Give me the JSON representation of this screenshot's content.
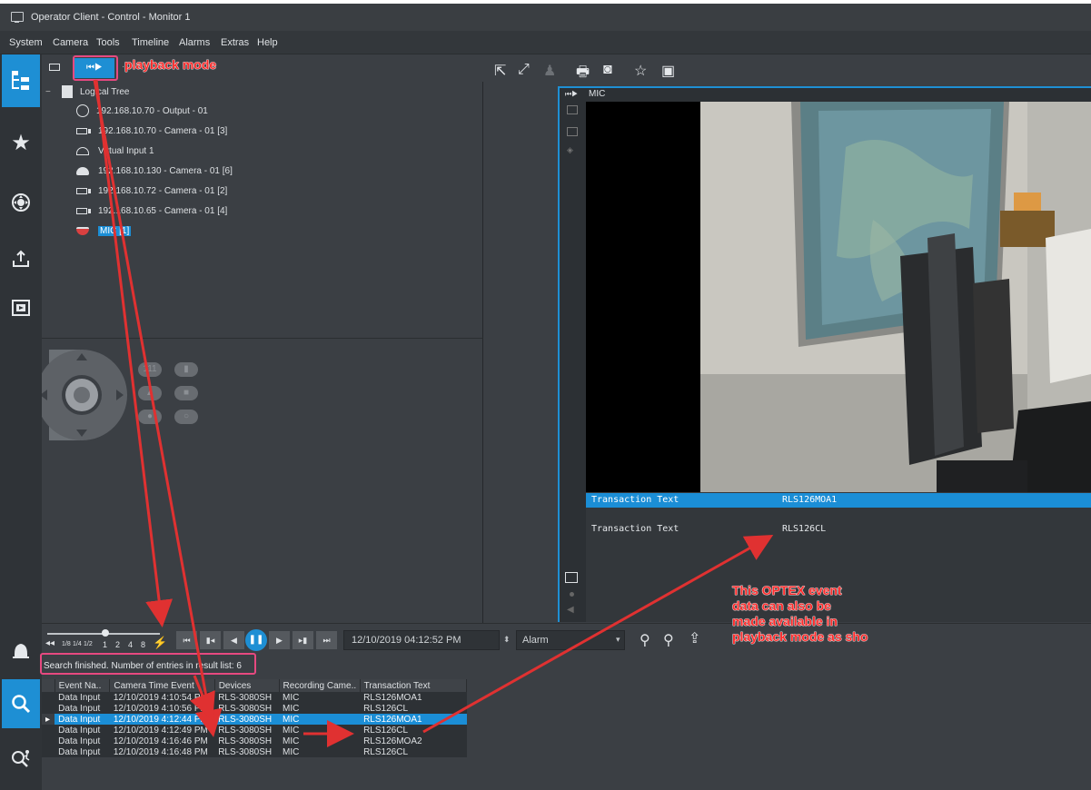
{
  "window": {
    "title": "Operator Client - Control - Monitor 1"
  },
  "menu": [
    "System",
    "Camera",
    "Tools",
    "Timeline",
    "Alarms",
    "Extras",
    "Help"
  ],
  "tree": {
    "root_label": "Logical Tree",
    "items": [
      {
        "label": "192.168.10.70 - Output - 01",
        "icon": "output-relay-icon"
      },
      {
        "label": "192.168.10.70 - Camera - 01 [3]",
        "icon": "camera-icon"
      },
      {
        "label": "Virtual Input 1",
        "icon": "virtual-input-icon"
      },
      {
        "label": "192.168.10.130 - Camera - 01 [6]",
        "icon": "dome-camera-icon"
      },
      {
        "label": "192.168.10.72 - Camera - 01 [2]",
        "icon": "camera-icon"
      },
      {
        "label": "192.168.10.65 - Camera - 01 [4]",
        "icon": "camera-icon"
      },
      {
        "label": "MIC [1]",
        "icon": "mic-camera-icon",
        "selected": true
      }
    ]
  },
  "ptz": {
    "zoom_plus": "+",
    "zoom_minus": "−"
  },
  "video": {
    "camera_name": "MIC",
    "transactions": [
      {
        "label": "Transaction Text",
        "value": "RLS126MOA1",
        "selected": true
      },
      {
        "label": "Transaction Text",
        "value": "RLS126CL",
        "selected": false
      }
    ]
  },
  "playback": {
    "speeds": [
      "1/8",
      "1/4",
      "1/2",
      "1",
      "2",
      "4",
      "8"
    ],
    "datetime": "12/10/2019 04:12:52 PM",
    "event_type": "Alarm"
  },
  "results": {
    "status": "Search finished. Number of entries in result list: 6",
    "columns": [
      "Event Na..",
      "Camera Time Event",
      "Devices",
      "Recording Came..",
      "Transaction Text"
    ],
    "rows": [
      [
        "Data Input",
        "12/10/2019 4:10:54 PM",
        "RLS-3080SH",
        "MIC",
        "RLS126MOA1"
      ],
      [
        "Data Input",
        "12/10/2019 4:10:56 PM",
        "RLS-3080SH",
        "MIC",
        "RLS126CL"
      ],
      [
        "Data Input",
        "12/10/2019 4:12:44 PM",
        "RLS-3080SH",
        "MIC",
        "RLS126MOA1"
      ],
      [
        "Data Input",
        "12/10/2019 4:12:49 PM",
        "RLS-3080SH",
        "MIC",
        "RLS126CL"
      ],
      [
        "Data Input",
        "12/10/2019 4:16:46 PM",
        "RLS-3080SH",
        "MIC",
        "RLS126MOA2"
      ],
      [
        "Data Input",
        "12/10/2019 4:16:48 PM",
        "RLS-3080SH",
        "MIC",
        "RLS126CL"
      ]
    ],
    "selected_row": 2
  },
  "annotations": {
    "playback_mode": "playback mode",
    "optex_note": [
      "This OPTEX event",
      "data can also be",
      "made available in",
      "playback mode as sho"
    ]
  },
  "colors": {
    "accent": "#1e8fd4",
    "panel": "#3b3f44",
    "annotation": "#ff2b2b"
  }
}
